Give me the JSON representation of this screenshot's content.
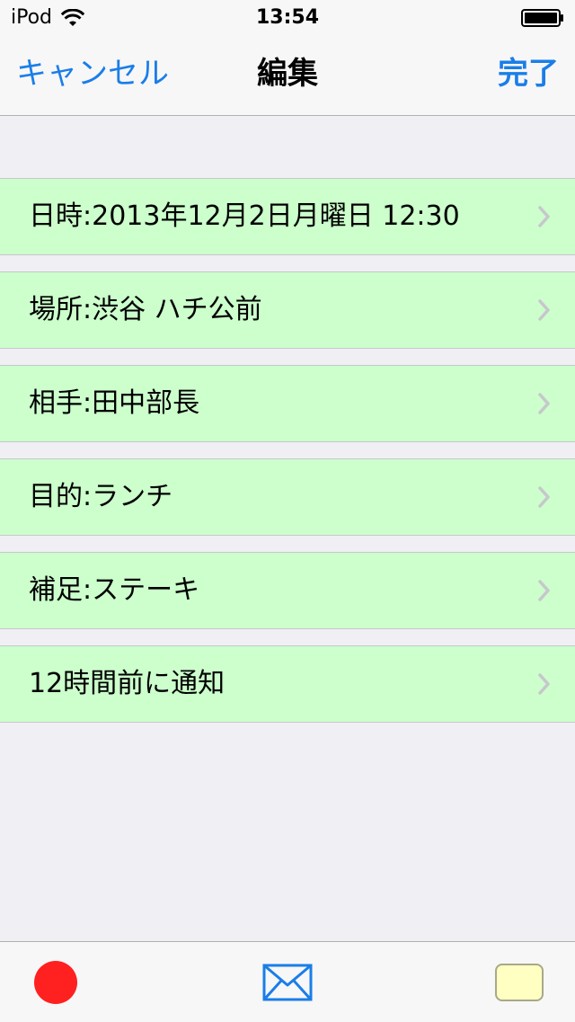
{
  "status_bar": {
    "carrier": "iPod",
    "time": "13:54"
  },
  "nav": {
    "cancel_label": "キャンセル",
    "title": "編集",
    "done_label": "完了"
  },
  "rows": [
    {
      "label": "日時:2013年12月2日月曜日 12:30"
    },
    {
      "label": "場所:渋谷 ハチ公前"
    },
    {
      "label": "相手:田中部長"
    },
    {
      "label": "目的:ランチ"
    },
    {
      "label": "補足:ステーキ"
    },
    {
      "label": "12時間前に通知"
    }
  ],
  "toolbar": {
    "items": [
      "record-icon",
      "mail-icon",
      "note-icon"
    ]
  },
  "colors": {
    "accent": "#1a7ee8",
    "row_background": "#ccffcc",
    "record": "#ff2020",
    "note": "#ffffc2"
  }
}
